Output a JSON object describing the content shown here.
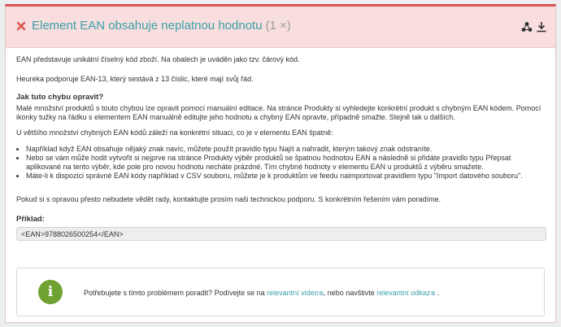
{
  "header": {
    "title": "Element EAN obsahuje neplatnou hodnotu",
    "count": "(1 ×)"
  },
  "body": {
    "p1": "EAN představuje unikátní číselný kód zboží. Na obalech je uváděn jako tzv. čárový kód.",
    "p2": "Heureka podporuje EAN-13, který sestává z 13 číslic, které mají svůj řád.",
    "heading_fix": "Jak tuto chybu opravit?",
    "p3": "Malé množství produktů s touto chybou lze opravit pomocí manuální editace. Na stránce Produkty si vyhledejte konkrétní produkt s chybným EAN kódem. Pomocí ikonky tužky na řádku s elementem EAN manuálně editujte jeho hodnotu a chybný EAN opravte, případně smažte. Stejně tak u dalších.",
    "p4": "U většího množství chybných EAN kódů záleží na konkrétní situaci, co je v elementu EAN špatně:",
    "bullets": [
      "Například když EAN obsahuje nějaký znak navíc, můžete použít pravidlo typu Najít a nahradit, kterým takový znak odstraníte.",
      "Nebo se vám může hodit vytvořit si nejprve na stránce Produkty výběr produktů se špatnou hodnotou EAN a následně si přidáte pravidlo typu Přepsat aplikované na tento výběr, kde pole pro novou hodnotu necháte prázdné. Tím chybné hodnoty v elementu EAN u produktů z výběru smažete.",
      "Máte-li k dispozici správné EAN kódy například v CSV souboru, můžete je k produktům ve feedu naimportovat pravidlem typu \"Import datového souboru\"."
    ],
    "p5": "Pokud si s opravou přesto nebudete vědět rady, kontaktujte prosím naši technickou podporu. S konkrétním řešením vám poradíme.",
    "example_label": "Příklad:",
    "example_code": "<EAN>9788026500254</EAN>"
  },
  "info": {
    "icon_glyph": "i",
    "text_before": "Potřebujete s tímto problémem poradit? Podívejte se na ",
    "link1": "relevantní video",
    "text_middle": ", nebo navštivte ",
    "link2": "relevantní odkaz",
    "text_after": " ."
  },
  "colors": {
    "accent_teal": "#3aa0a8",
    "error_red": "#d9534f",
    "header_bg": "#f8dede",
    "info_green": "#6fa232"
  },
  "icons": [
    "close-x-icon",
    "share-icon",
    "download-icon",
    "info-icon",
    "external-link-icon"
  ]
}
